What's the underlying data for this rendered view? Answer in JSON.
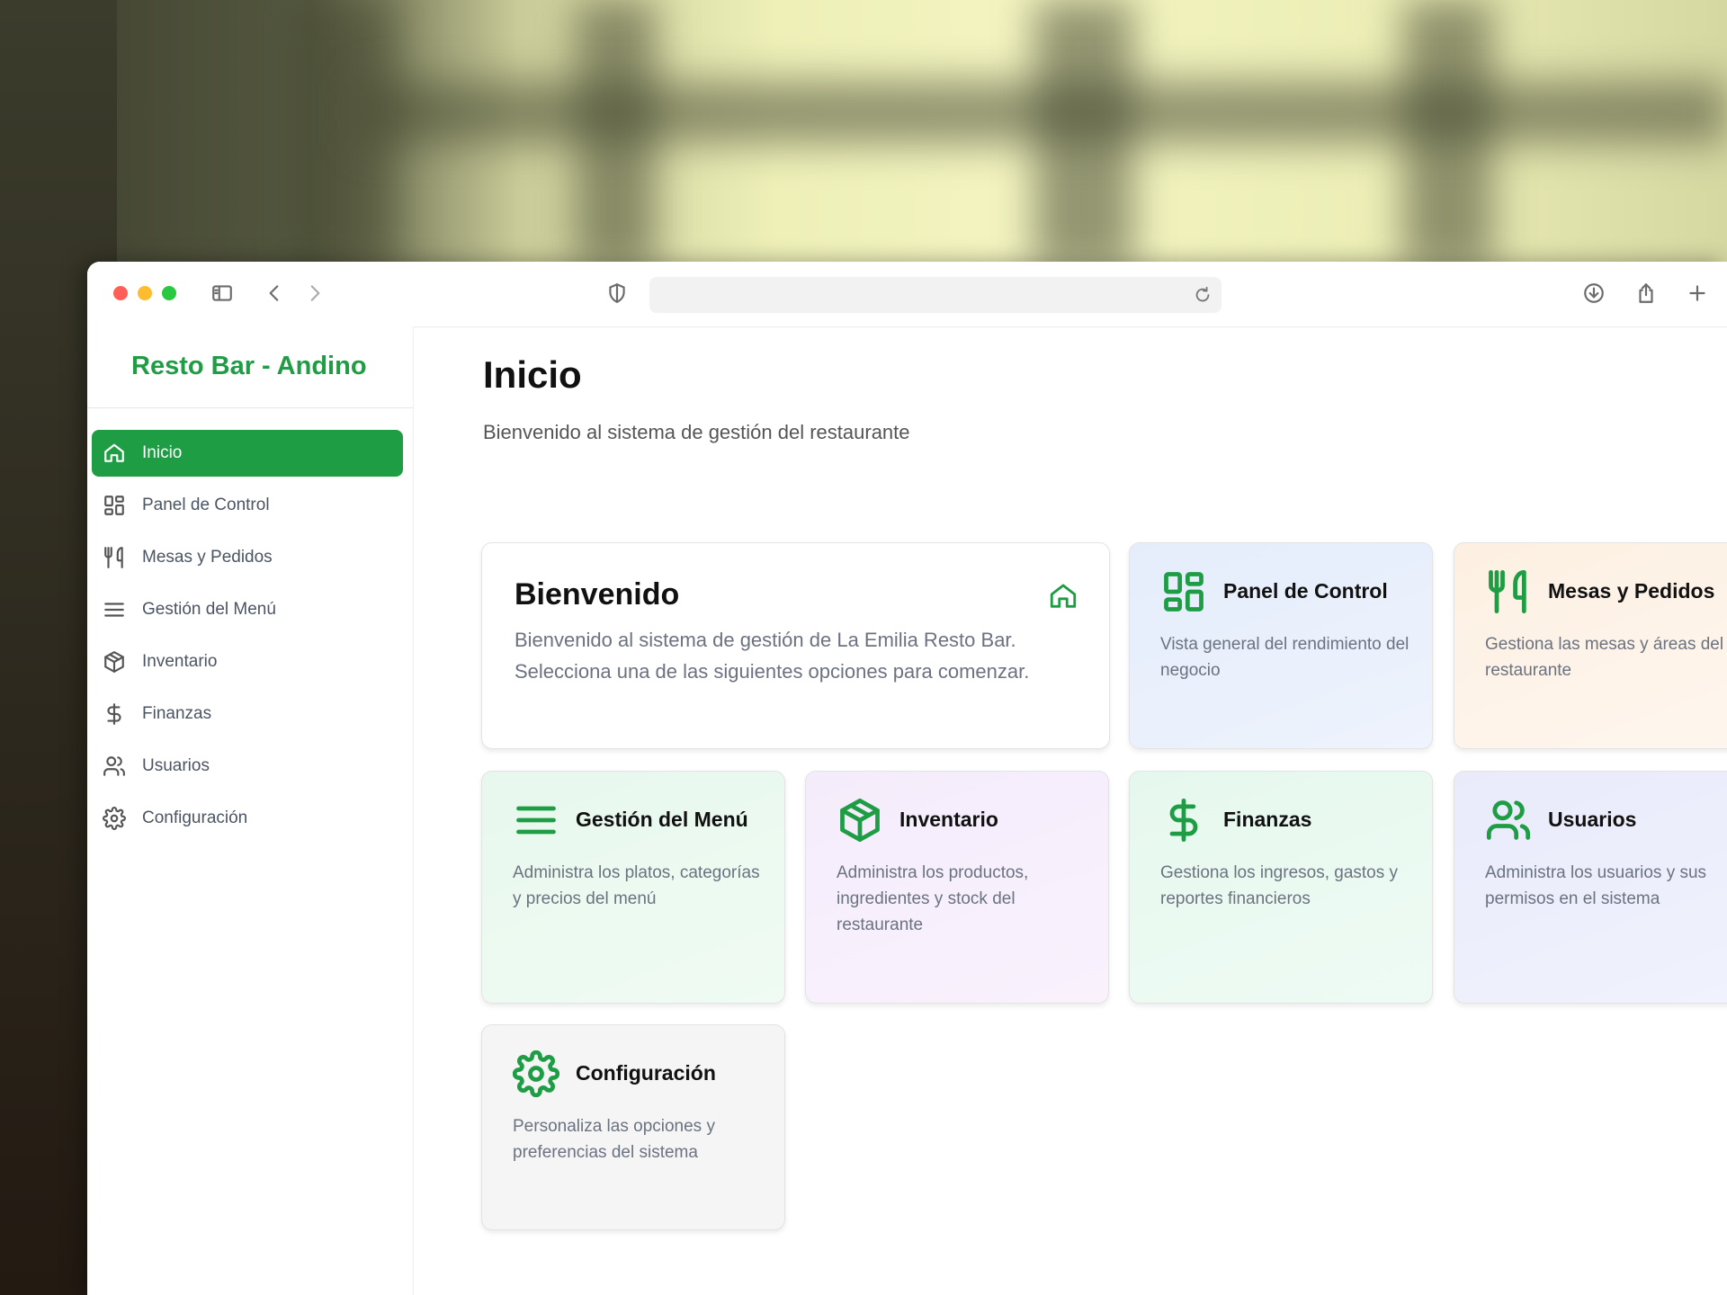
{
  "brand": {
    "title": "Resto Bar - Andino",
    "accent": "#1f9d45"
  },
  "nav": [
    {
      "label": "Inicio",
      "icon": "home-icon",
      "active": true
    },
    {
      "label": "Panel de Control",
      "icon": "dashboard-icon"
    },
    {
      "label": "Mesas y Pedidos",
      "icon": "utensils-icon"
    },
    {
      "label": "Gestión del Menú",
      "icon": "menu-icon"
    },
    {
      "label": "Inventario",
      "icon": "package-icon"
    },
    {
      "label": "Finanzas",
      "icon": "dollar-icon"
    },
    {
      "label": "Usuarios",
      "icon": "users-icon"
    },
    {
      "label": "Configuración",
      "icon": "gear-icon"
    }
  ],
  "page": {
    "title": "Inicio",
    "subtitle": "Bienvenido al sistema de gestión del restaurante"
  },
  "welcome": {
    "title": "Bienvenido",
    "text": "Bienvenido al sistema de gestión de La Emilia Resto Bar. Selecciona una de las siguientes opciones para comenzar."
  },
  "cards": [
    {
      "title": "Panel de Control",
      "desc": "Vista general del rendimiento del negocio",
      "icon": "dashboard-icon"
    },
    {
      "title": "Mesas y Pedidos",
      "desc": "Gestiona las mesas y áreas del restaurante",
      "icon": "utensils-icon"
    },
    {
      "title": "Gestión del Menú",
      "desc": "Administra los platos, categorías y precios del menú",
      "icon": "menu-icon"
    },
    {
      "title": "Inventario",
      "desc": "Administra los productos, ingredientes y stock del restaurante",
      "icon": "package-icon"
    },
    {
      "title": "Finanzas",
      "desc": "Gestiona los ingresos, gastos y reportes financieros",
      "icon": "dollar-icon"
    },
    {
      "title": "Usuarios",
      "desc": "Administra los usuarios y sus permisos en el sistema",
      "icon": "users-icon"
    },
    {
      "title": "Configuración",
      "desc": "Personaliza las opciones y preferencias del sistema",
      "icon": "gear-icon"
    }
  ],
  "browser": {
    "address_value": ""
  }
}
